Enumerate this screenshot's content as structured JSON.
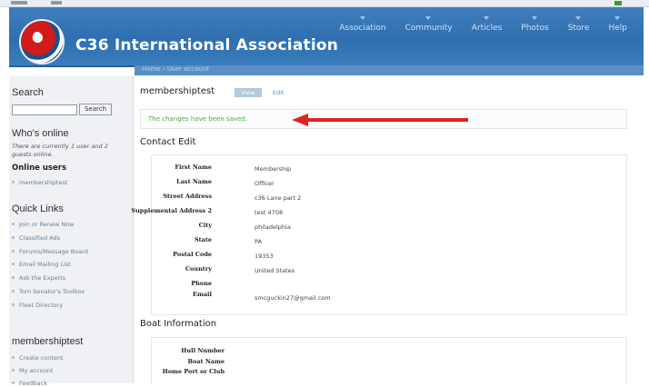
{
  "header": {
    "site_title": "C36 International Association",
    "nav": [
      "Association",
      "Community",
      "Articles",
      "Photos",
      "Store",
      "Help"
    ]
  },
  "breadcrumb": [
    "Home",
    "User account"
  ],
  "sidebar": {
    "search": {
      "title": "Search",
      "input_value": "",
      "button_label": "Search"
    },
    "whos_online": {
      "title": "Who's online",
      "text": "There are currently 1 user and 2 guests online.",
      "online_users_label": "Online users",
      "users": [
        "membershiptest"
      ]
    },
    "quick_links": {
      "title": "Quick Links",
      "items": [
        "Join or Renew Now",
        "Classified Ads",
        "Forums/Message Board",
        "Email Mailing List",
        "Ask the Experts",
        "Tom Senator's Toolbox",
        "Fleet Directory"
      ]
    },
    "user_menu": {
      "title": "membershiptest",
      "items": [
        "Create content",
        "My account",
        "Feedback"
      ]
    }
  },
  "main": {
    "title": "membershiptest",
    "tabs": {
      "view": "View",
      "edit": "Edit"
    },
    "status_message": "The changes have been saved.",
    "contact": {
      "title": "Contact Edit",
      "fields": [
        {
          "label": "First Name",
          "value": "Membership"
        },
        {
          "label": "Last Name",
          "value": "Officer"
        },
        {
          "label": "Street Address",
          "value": "c36 Lane part 2"
        },
        {
          "label": "Supplemental Address 2",
          "value": "test 4708"
        },
        {
          "label": "City",
          "value": "philadelphia"
        },
        {
          "label": "State",
          "value": "PA"
        },
        {
          "label": "Postal Code",
          "value": "19353"
        },
        {
          "label": "Country",
          "value": "United States"
        },
        {
          "label": "Phone",
          "value": ""
        },
        {
          "label": "Email",
          "value": "smcguckin27@gmail.com"
        }
      ]
    },
    "boat": {
      "title": "Boat Information",
      "fields": [
        {
          "label": "Hull Number",
          "value": ""
        },
        {
          "label": "Boat Name",
          "value": ""
        },
        {
          "label": "Home Port or Club",
          "value": ""
        }
      ]
    }
  },
  "colors": {
    "header_blue": "#2f6fb0",
    "arrow_red": "#e12222",
    "status_green": "#5ea54a"
  }
}
